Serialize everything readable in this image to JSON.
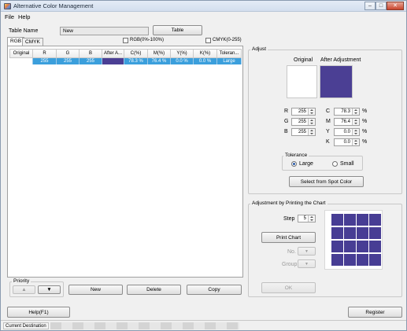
{
  "window": {
    "title": "Alternative Color Management",
    "controls": {
      "minimize": "–",
      "maximize": "□",
      "close": "✕"
    }
  },
  "menu": {
    "file": "File",
    "help": "Help"
  },
  "table_name": {
    "label": "Table Name",
    "value": "New",
    "button": "Table"
  },
  "tabs": [
    "RGB",
    "CMYK"
  ],
  "options": {
    "rgb_range": "RGB(0%-100%)",
    "cmyk_range": "CMYK(0-255)"
  },
  "grid": {
    "headers": [
      "Original",
      "R",
      "G",
      "B",
      "After A...",
      "C(%)",
      "M(%)",
      "Y(%)",
      "K(%)",
      "Toleran..."
    ],
    "rows": [
      {
        "r": "255",
        "g": "255",
        "b": "255",
        "c": "78.3 %",
        "m": "76.4 %",
        "y": "0.0 %",
        "k": "0.0 %",
        "tolerance": "Large"
      }
    ]
  },
  "priority": {
    "label": "Priority",
    "up": "▲",
    "down": "▼"
  },
  "list_buttons": {
    "new": "New",
    "delete": "Delete",
    "copy": "Copy"
  },
  "adjust": {
    "title": "Adjust",
    "original_label": "Original",
    "after_label": "After Adjustment",
    "after_color": "#4b3f94",
    "r_label": "R",
    "r_value": "255",
    "g_label": "G",
    "g_value": "255",
    "b_label": "B",
    "b_value": "255",
    "c_label": "C",
    "c_value": "78.3",
    "m_label": "M",
    "m_value": "76.4",
    "y_label": "Y",
    "y_value": "0.0",
    "k_label": "K",
    "k_value": "0.0",
    "percent": "%",
    "tolerance_title": "Tolerance",
    "tolerance_large": "Large",
    "tolerance_small": "Small",
    "select_spot_button": "Select from Spot Color"
  },
  "print_chart": {
    "title": "Adjustment by Printing the Chart",
    "step_label": "Step",
    "step_value": "5",
    "print_button": "Print Chart",
    "no_label": "No.",
    "group_label": "Group",
    "ok_button": "OK",
    "chart_color": "#473d94"
  },
  "bottom": {
    "help_button": "Help(F1)",
    "register_button": "Register"
  },
  "status": {
    "current_destination": "Current Destination"
  }
}
